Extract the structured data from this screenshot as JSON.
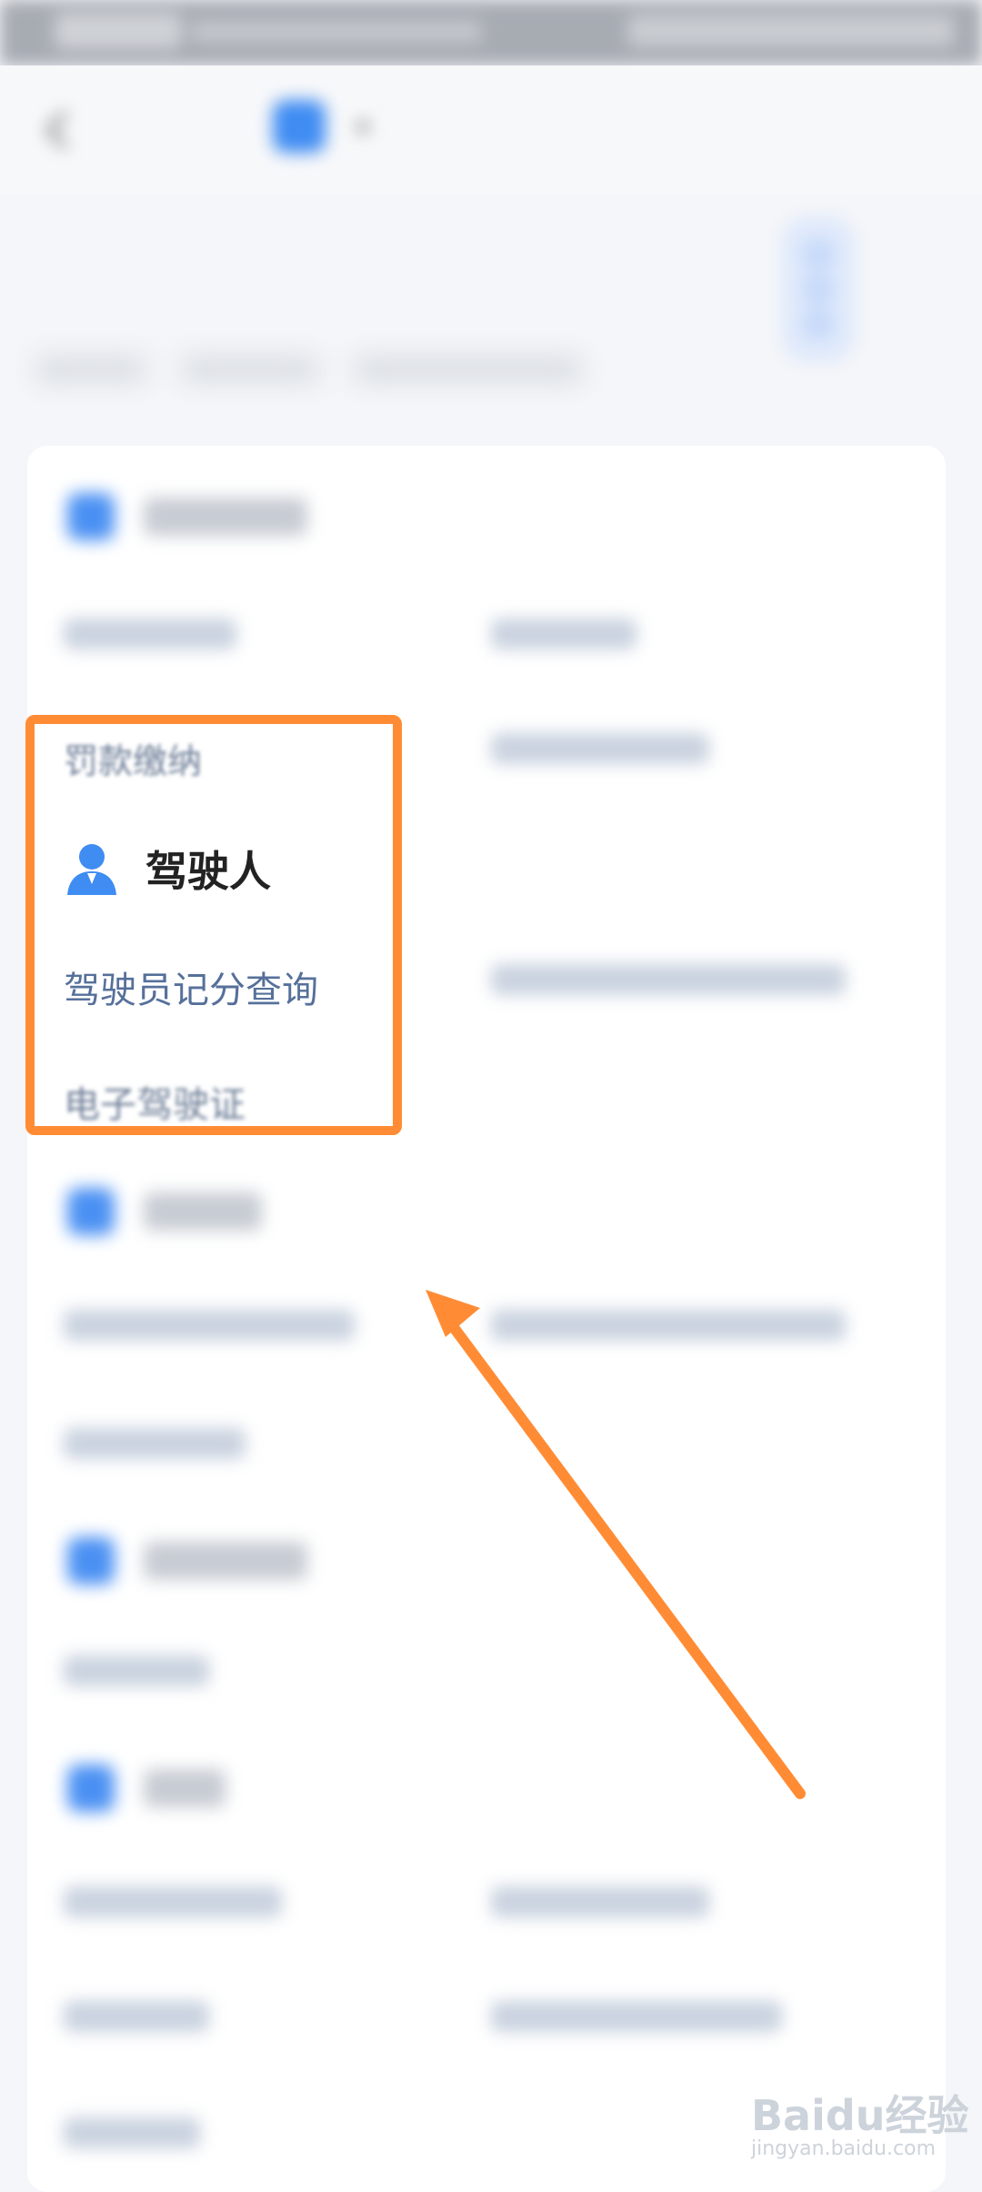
{
  "header": {
    "page_title": "",
    "app_name": ""
  },
  "sections": {
    "driver": {
      "title": "驾驶人",
      "links": [
        "驾驶员记分查询",
        "电子驾驶证"
      ]
    }
  },
  "partial_texts": {
    "fine_payment": "罚款缴纳"
  },
  "colors": {
    "accent": "#ff8c35",
    "primary_blue": "#3f8cf2",
    "link_text": "#56709a"
  },
  "watermark": {
    "brand": "Baidu经验",
    "url": "jingyan.baidu.com"
  }
}
